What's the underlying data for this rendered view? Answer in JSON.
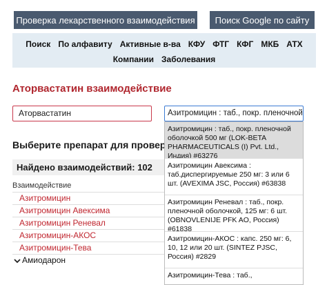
{
  "header": {
    "check_button": "Проверка лекарственного взаимодействия",
    "google_button": "Поиск Google по сайту"
  },
  "nav": {
    "row1": [
      "Поиск",
      "По алфавиту",
      "Активные в-ва",
      "КФУ",
      "ФТГ",
      "КФГ",
      "МКБ",
      "АТХ"
    ],
    "row2": [
      "Компании",
      "Заболевания"
    ]
  },
  "page_title": "Аторвастатин взаимодействие",
  "inputs": {
    "drug1_value": "Аторвастатин",
    "drug2_value": "Азитромицин : таб., покр. пленочной об"
  },
  "select_label": "Выберите препарат для проверки",
  "found_count_label": "Найдено взаимодействий: 102",
  "column_header": "Взаимодействие",
  "results": [
    "Азитромицин",
    "Азитромицин Авексима",
    "Азитромицин Реневал",
    "Азитромицин-АКОС",
    "Азитромицин-Тева",
    "Амиодарон"
  ],
  "dropdown": [
    "Азитромицин : таб., покр. пленочной оболочкой 500 мг (LOK-BETA PHARMACEUTICALS (I) Pvt. Ltd., Индия) #63276",
    "Азитромицин Авексима : таб.диспергируемые 250 мг: 3 или 6 шт. (AVEXIMA JSC, Россия) #63838",
    "Азитромицин Реневал : таб., покр. пленочной оболочкой, 125 мг: 6 шт. (OBNOVLENIJE PFK AO, Россия) #61838",
    "Азитромицин-АКОС : капс. 250 мг: 6, 10, 12 или 20 шт. (SINTEZ PJSC, Россия) #2829",
    "Азитромицин-Тева : таб.,"
  ],
  "icons": {
    "expand": "chevron-down-icon"
  },
  "colors": {
    "accent": "#b0262e",
    "header_button_bg": "#4a5a6f",
    "nav_bg": "#e3ecf3",
    "focus_border": "#3b7bd3"
  }
}
